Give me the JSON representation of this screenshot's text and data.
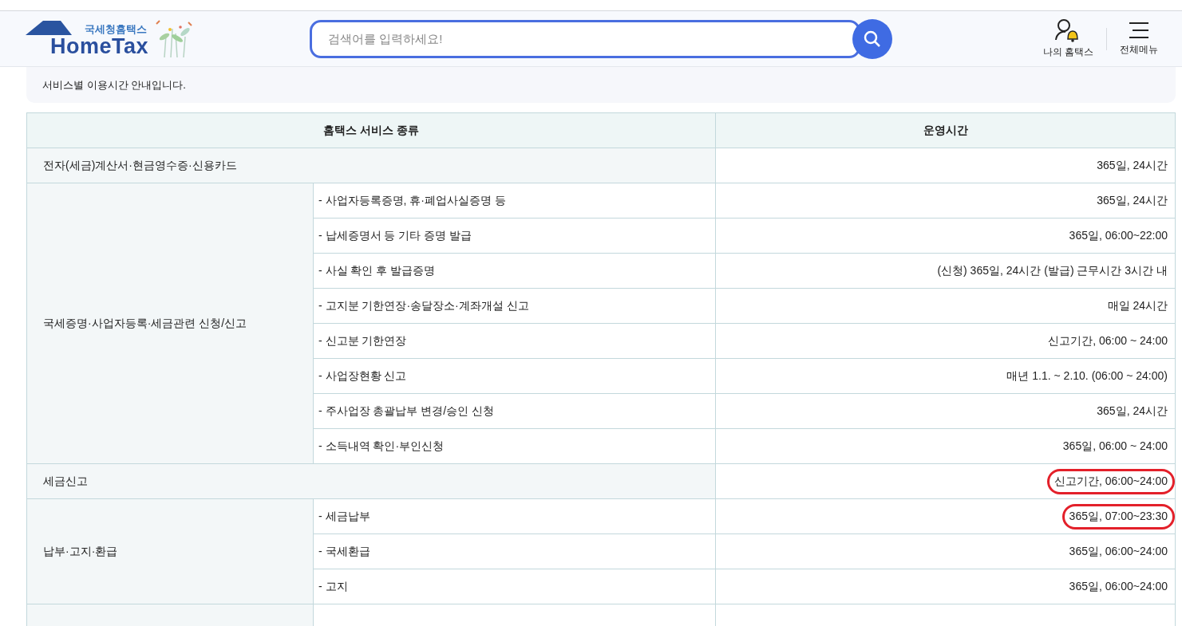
{
  "header": {
    "logo": {
      "subtitle": "국세청홈택스",
      "title": "HomeTax"
    },
    "search": {
      "placeholder": "검색어를 입력하세요!"
    },
    "actions": [
      {
        "kind": "my",
        "label": "나의 홈택스"
      },
      {
        "kind": "menu",
        "label": "전체메뉴"
      }
    ]
  },
  "notice": "서비스별 이용시간 안내입니다.",
  "table": {
    "columns": [
      "홈택스 서비스 종류",
      "운영시간"
    ],
    "groups": [
      {
        "kind": "single",
        "category": "전자(세금)계산서·현금영수증·신용카드",
        "hours": "365일, 24시간",
        "circled": false
      },
      {
        "kind": "grouped",
        "category": "국세증명·사업자등록·세금관련 신청/신고",
        "items": [
          {
            "service": "- 사업자등록증명, 휴·폐업사실증명 등",
            "hours": "365일, 24시간",
            "circled": false
          },
          {
            "service": "- 납세증명서 등 기타 증명 발급",
            "hours": "365일, 06:00~22:00",
            "circled": false
          },
          {
            "service": "- 사실 확인 후 발급증명",
            "hours": "(신청) 365일, 24시간 (발급) 근무시간 3시간 내",
            "circled": false
          },
          {
            "service": "- 고지분 기한연장·송달장소·계좌개설 신고",
            "hours": "매일 24시간",
            "circled": false
          },
          {
            "service": "- 신고분 기한연장",
            "hours": "신고기간, 06:00 ~ 24:00",
            "circled": false
          },
          {
            "service": "- 사업장현황 신고",
            "hours": "매년 1.1. ~ 2.10. (06:00 ~ 24:00)",
            "circled": false
          },
          {
            "service": "- 주사업장 총괄납부 변경/승인 신청",
            "hours": "365일, 24시간",
            "circled": false
          },
          {
            "service": "- 소득내역 확인·부인신청",
            "hours": "365일, 06:00 ~ 24:00",
            "circled": false
          }
        ]
      },
      {
        "kind": "single",
        "category": "세금신고",
        "hours": "신고기간, 06:00~24:00",
        "circled": true
      },
      {
        "kind": "grouped",
        "category": "납부·고지·환급",
        "items": [
          {
            "service": "- 세금납부",
            "hours": "365일, 07:00~23:30",
            "circled": true
          },
          {
            "service": "- 국세환급",
            "hours": "365일, 06:00~24:00",
            "circled": false
          },
          {
            "service": "- 고지",
            "hours": "365일, 06:00~24:00",
            "circled": false
          }
        ]
      }
    ]
  }
}
